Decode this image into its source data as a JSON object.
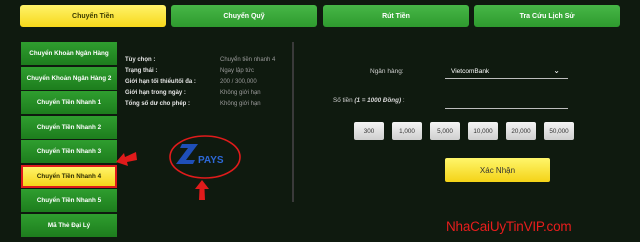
{
  "tabs": [
    {
      "label": "Chuyển Tiền",
      "active": true
    },
    {
      "label": "Chuyển Quỹ",
      "active": false
    },
    {
      "label": "Rút Tiền",
      "active": false
    },
    {
      "label": "Tra Cứu Lịch Sử",
      "active": false
    }
  ],
  "sidebar": {
    "items": [
      {
        "label": "Chuyển Khoản Ngân Hàng"
      },
      {
        "label": "Chuyển Khoản Ngân Hàng 2"
      },
      {
        "label": "Chuyển Tiền Nhanh 1"
      },
      {
        "label": "Chuyển Tiền Nhanh 2"
      },
      {
        "label": "Chuyển Tiền Nhanh 3"
      },
      {
        "label": "Chuyển Tiền Nhanh 4",
        "active": true
      },
      {
        "label": "Chuyển Tiền Nhanh 5"
      },
      {
        "label": "Mã Thẻ Đại Lý"
      }
    ]
  },
  "info": {
    "rows": [
      {
        "key": "Tùy chọn :",
        "value": "Chuyển tiền nhanh 4"
      },
      {
        "key": "Trạng thái :",
        "value": "Ngay lập tức"
      },
      {
        "key": "Giới hạn tối thiểu/tối đa :",
        "value": "200 / 300,000"
      },
      {
        "key": "Giới hạn trong ngày :",
        "value": "Không giới hạn"
      },
      {
        "key": "Tổng số dư cho phép :",
        "value": "Không giới hạn"
      }
    ]
  },
  "logo": {
    "text": "PAYS",
    "letter": "Z"
  },
  "form": {
    "bank_label": "Ngân hàng:",
    "bank_value": "VietcomBank",
    "amount_label": "Số tiền",
    "amount_note": "(1 = 1000 Đồng)",
    "amount_suffix": ":",
    "amount_value": "",
    "quick_amounts": [
      "300",
      "1,000",
      "5,000",
      "10,000",
      "20,000",
      "50,000"
    ],
    "confirm_label": "Xác Nhận"
  },
  "watermark": "NhaCaiUyTinVIP.com",
  "colors": {
    "background": "#0f1a0f",
    "tab_green": "#3aa83a",
    "active_yellow": "#f7d81a",
    "highlight_red": "#e01b1b",
    "logo_blue": "#1f4fb8"
  }
}
